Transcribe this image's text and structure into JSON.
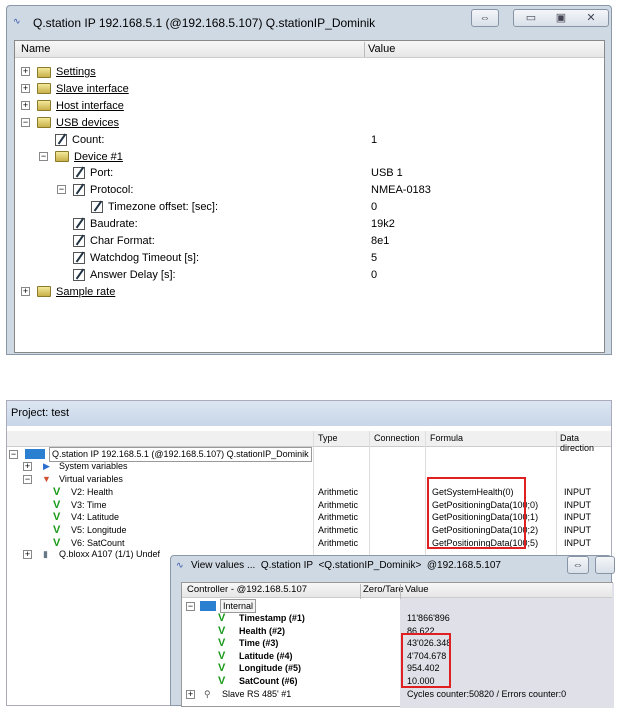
{
  "config_window": {
    "title": "Q.station IP 192.168.5.1 (@192.168.5.107) Q.stationIP_Dominik",
    "columns": [
      "Name",
      "Value"
    ],
    "rows": [
      {
        "label": "Settings",
        "value": "",
        "kind": "folder",
        "expander": "+"
      },
      {
        "label": "Slave interface",
        "value": "",
        "kind": "folder",
        "expander": "+"
      },
      {
        "label": "Host interface",
        "value": "",
        "kind": "folder",
        "expander": "+"
      },
      {
        "label": "USB devices",
        "value": "",
        "kind": "folder",
        "expander": "-"
      },
      {
        "label": "Count:",
        "value": "1",
        "kind": "prop"
      },
      {
        "label": "Device #1",
        "value": "",
        "kind": "folder",
        "expander": "-"
      },
      {
        "label": "Port:",
        "value": "USB 1",
        "kind": "prop"
      },
      {
        "label": "Protocol:",
        "value": "NMEA-0183",
        "kind": "prop",
        "expander": "-"
      },
      {
        "label": "Timezone offset: [sec]:",
        "value": "0",
        "kind": "prop"
      },
      {
        "label": "Baudrate:",
        "value": "19k2",
        "kind": "prop"
      },
      {
        "label": "Char Format:",
        "value": "8e1",
        "kind": "prop"
      },
      {
        "label": "Watchdog Timeout [s]:",
        "value": "5",
        "kind": "prop"
      },
      {
        "label": "Answer Delay [s]:",
        "value": "0",
        "kind": "prop"
      },
      {
        "label": "Sample rate",
        "value": "",
        "kind": "folder",
        "expander": "+"
      }
    ]
  },
  "project_window": {
    "title": "Project: test",
    "columns": [
      "",
      "Type",
      "Connection",
      "Formula",
      "Data direction"
    ],
    "root": "Q.station IP 192.168.5.1 (@192.168.5.107) Q.stationIP_Dominik",
    "groups": [
      "System variables",
      "Virtual variables"
    ],
    "variables": [
      {
        "name": "V2: Health",
        "type": "Arithmetic",
        "formula": "GetSystemHealth(0)",
        "direction": "INPUT"
      },
      {
        "name": "V3: Time",
        "type": "Arithmetic",
        "formula": "GetPositioningData(100;0)",
        "direction": "INPUT"
      },
      {
        "name": "V4: Latitude",
        "type": "Arithmetic",
        "formula": "GetPositioningData(100;1)",
        "direction": "INPUT"
      },
      {
        "name": "V5: Longitude",
        "type": "Arithmetic",
        "formula": "GetPositioningData(100;2)",
        "direction": "INPUT"
      },
      {
        "name": "V6: SatCount",
        "type": "Arithmetic",
        "formula": "GetPositioningData(100;5)",
        "direction": "INPUT"
      }
    ],
    "other_device": "Q.bloxx A107 (1/1) Undef"
  },
  "values_window": {
    "title": "View values ...  Q.station IP  <Q.stationIP_Dominik>  @192.168.5.107",
    "columns": [
      "Controller - @192.168.5.107",
      "Zero/Tare",
      "Value"
    ],
    "group": "Internal",
    "rows": [
      {
        "name": "Timestamp (#1)",
        "value": "11'866'896"
      },
      {
        "name": "Health (#2)",
        "value": "86.622"
      },
      {
        "name": "Time (#3)",
        "value": "43'026.348"
      },
      {
        "name": "Latitude (#4)",
        "value": "4'704.678"
      },
      {
        "name": "Longitude (#5)",
        "value": "954.402"
      },
      {
        "name": "SatCount (#6)",
        "value": "10.000"
      }
    ],
    "slave": "Slave RS 485' #1",
    "slave_status": "Cycles counter:50820 / Errors counter:0"
  },
  "colors": {
    "highlight_box": "#e02020",
    "check": "#1a9a1a",
    "titlebar": "#cfd9e4"
  }
}
